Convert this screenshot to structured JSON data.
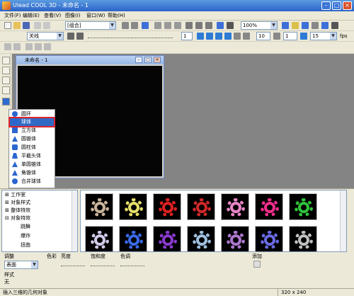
{
  "window": {
    "title": "Ulead COOL 3D - 未命名 - 1",
    "min": "–",
    "max": "□",
    "close": "×"
  },
  "menubar": [
    "文件(F)",
    "编辑(E)",
    "查看(V)",
    "图像(I)",
    "窗口(W)",
    "帮助(H)"
  ],
  "toolbar": {
    "object_combo": "[组合]",
    "zoom_combo": "100%",
    "font_combo": "关线",
    "spin1": "1",
    "spin2": "10",
    "spin3": "1",
    "fps_value": "15",
    "fps_label": "fps"
  },
  "child_window": {
    "title": "未命名 - 1",
    "min": "–",
    "max": "□",
    "close": "×"
  },
  "shape_menu": {
    "items": [
      "圆环",
      "球体",
      "立方体",
      "圆锥体",
      "圆柱体",
      "平截头体",
      "单圆锥体",
      "角锥体",
      "合并球体"
    ],
    "selected_index": 1
  },
  "tree": {
    "items": [
      "工作室",
      "对象样式",
      "整体特效",
      "对象特效",
      "跳舞",
      "爆炸",
      "扭曲"
    ]
  },
  "thumbs": {
    "colors": [
      "#c8b49a",
      "#e6df6a",
      "#e02020",
      "#d02828",
      "#e887c8",
      "#ef2e8a",
      "#2fc43a",
      "#d3c9ea",
      "#3b6ae8",
      "#8b3bd0",
      "#9fc0df",
      "#ad78ce",
      "#6a6ae4",
      "#c0c0c0"
    ]
  },
  "controls": {
    "adjust_label": "调整",
    "color_label": "色彩",
    "hue_label": "亮度",
    "saturation_label": "饱和度",
    "tint_label": "色调",
    "add_label": "添加",
    "surface_combo": "表面",
    "style_label": "样式",
    "style_value": "无"
  },
  "status": {
    "text": "插入三维的几何对象",
    "size": "320 x 240"
  }
}
